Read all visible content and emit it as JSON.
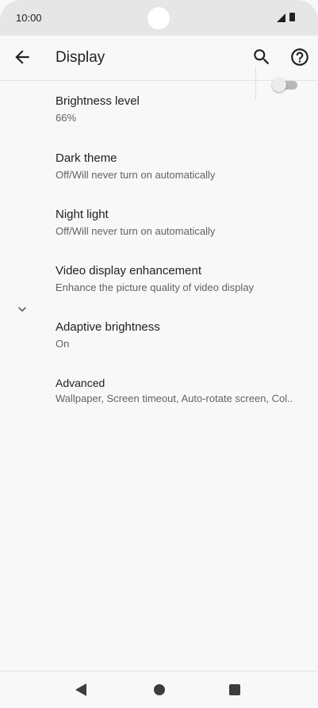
{
  "status_bar": {
    "time": "10:00"
  },
  "app_bar": {
    "title": "Display"
  },
  "settings": [
    {
      "title": "Brightness level",
      "summary": "66%"
    },
    {
      "title": "Dark theme",
      "summary": "Off/Will never turn on automatically",
      "toggle_on": false
    },
    {
      "title": "Night light",
      "summary": "Off/Will never turn on automatically"
    },
    {
      "title": "Video display enhancement",
      "summary": "Enhance the picture quality of video display"
    },
    {
      "title": "Adaptive brightness",
      "summary": "On"
    },
    {
      "title": "Advanced",
      "summary": "Wallpaper, Screen timeout, Auto-rotate screen, Col.."
    }
  ],
  "icons": {
    "back": "arrow-back-icon",
    "search": "search-icon",
    "help": "help-icon",
    "expand": "chevron-down-icon"
  },
  "colors": {
    "background": "#f8f8f8",
    "status_bar": "#e6e6e6",
    "text_primary": "#202124",
    "text_secondary": "#5f6368"
  }
}
